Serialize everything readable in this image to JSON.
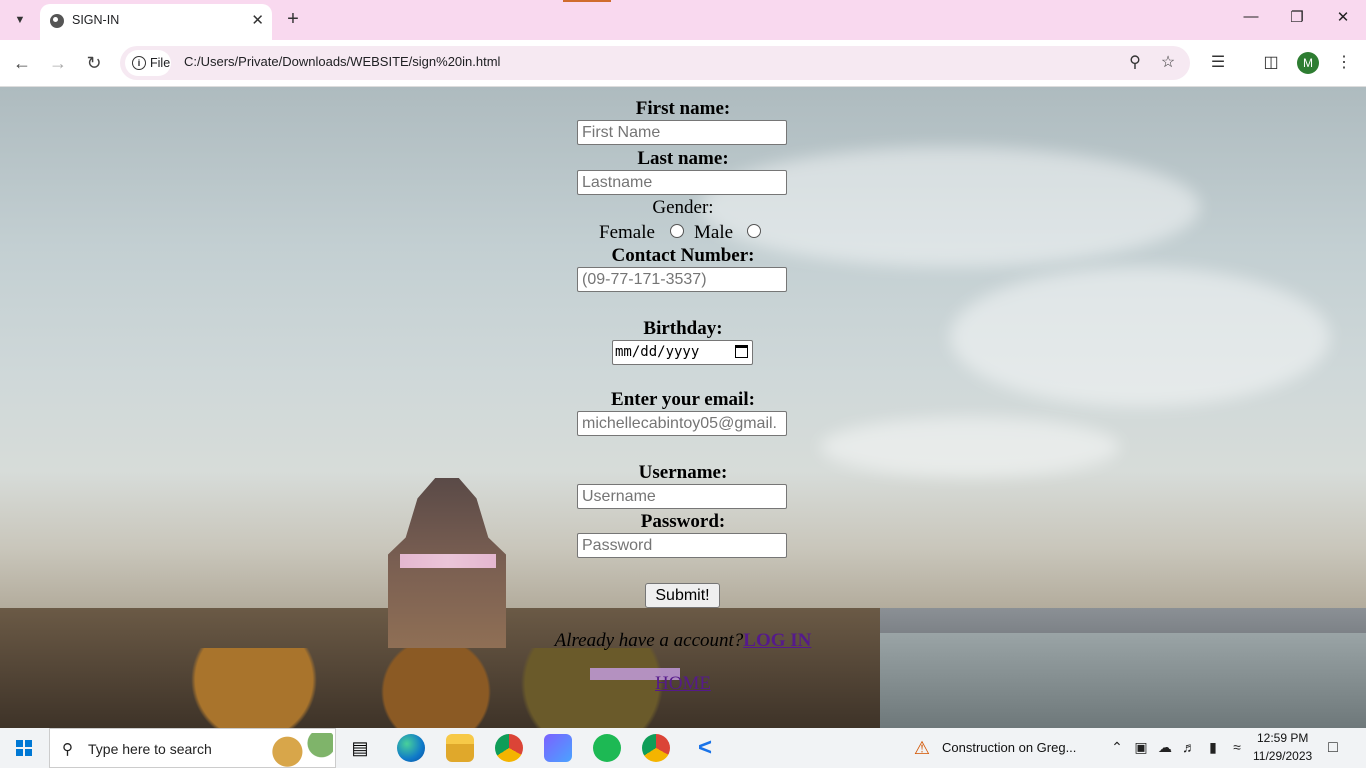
{
  "browser": {
    "tab_title": "SIGN-IN",
    "url": "C:/Users/Private/Downloads/WEBSITE/sign%20in.html",
    "site_info_label": "File",
    "profile_initial": "M"
  },
  "form": {
    "first_name_label": "First name:",
    "first_name_placeholder": "First Name",
    "last_name_label": "Last name:",
    "last_name_placeholder": "Lastname",
    "gender_label": "Gender:",
    "gender_female": "Female",
    "gender_male": "Male",
    "contact_label": "Contact Number:",
    "contact_placeholder": "(09-77-171-3537)",
    "birthday_label": "Birthday:",
    "birthday_placeholder": "mm/dd/yyyy",
    "email_label": "Enter your email:",
    "email_placeholder": "michellecabintoy05@gmail.",
    "username_label": "Username:",
    "username_placeholder": "Username",
    "password_label": "Password:",
    "password_placeholder": "Password",
    "submit_label": "Submit!",
    "already_text": "Already have a account?",
    "login_link": "LOG IN",
    "home_link": "HOME"
  },
  "taskbar": {
    "search_placeholder": "Type here to search",
    "notification_text": "Construction on Greg...",
    "time": "12:59 PM",
    "date": "11/29/2023"
  },
  "colors": {
    "tab_strip": "#f9d9ef",
    "link": "#551a8b",
    "accent": "#0078d4"
  }
}
